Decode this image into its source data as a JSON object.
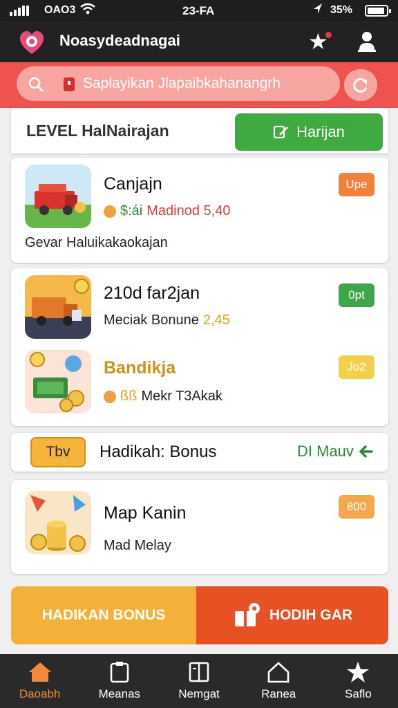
{
  "status_bar": {
    "carrier": "OAO3",
    "time": "23-FA",
    "battery": "35%"
  },
  "app_bar": {
    "title": "Noasydeadnagai",
    "icons": [
      "heart-logo-icon",
      "star-icon",
      "user-icon"
    ]
  },
  "search": {
    "value": "Saplayikan Jlapaibkahanangrh",
    "placeholder": ""
  },
  "level": {
    "title": "LEVEL HalNairajan",
    "button": "Harijan"
  },
  "items": [
    {
      "title": "Canjajn",
      "sub_prefix": "$:ái",
      "sub_value": "Madinod 5,40",
      "desc": "Gevar Haluikakaokajan",
      "badge": "Upe",
      "badge_color": "#f0803c"
    },
    {
      "title": "210d far2jan",
      "sub_prefix": "Meciak Bonune",
      "sub_value": "2,45",
      "badge": "0pt",
      "badge_color": "#3da64a"
    },
    {
      "title": "Bandikja",
      "sub_prefix": "ßß",
      "sub_value": "Mekr T3Akak",
      "badge": "Jo2",
      "badge_color": "#f2d04a"
    },
    {
      "title": "Map Kanin",
      "sub_value": "Mad Melay",
      "badge": "800",
      "badge_color": "#f4a74c"
    }
  ],
  "bonus_row": {
    "tag": "Tbv",
    "title": "Hadikah: Bonus",
    "link": "DI Mauv"
  },
  "cta": {
    "left": "HADIKAN BONUS",
    "right": "HODIH GAR"
  },
  "nav": [
    {
      "label": "Daoabh",
      "icon": "home-icon",
      "active": true
    },
    {
      "label": "Meanas",
      "icon": "clipboard-icon",
      "active": false
    },
    {
      "label": "Nemgat",
      "icon": "book-icon",
      "active": false
    },
    {
      "label": "Ranea",
      "icon": "house-outline-icon",
      "active": false
    },
    {
      "label": "Saflo",
      "icon": "star-icon",
      "active": false
    }
  ],
  "colors": {
    "accent_red": "#ef5350",
    "green": "#3faa3f",
    "orange": "#e75225",
    "gold": "#f4b13a"
  }
}
